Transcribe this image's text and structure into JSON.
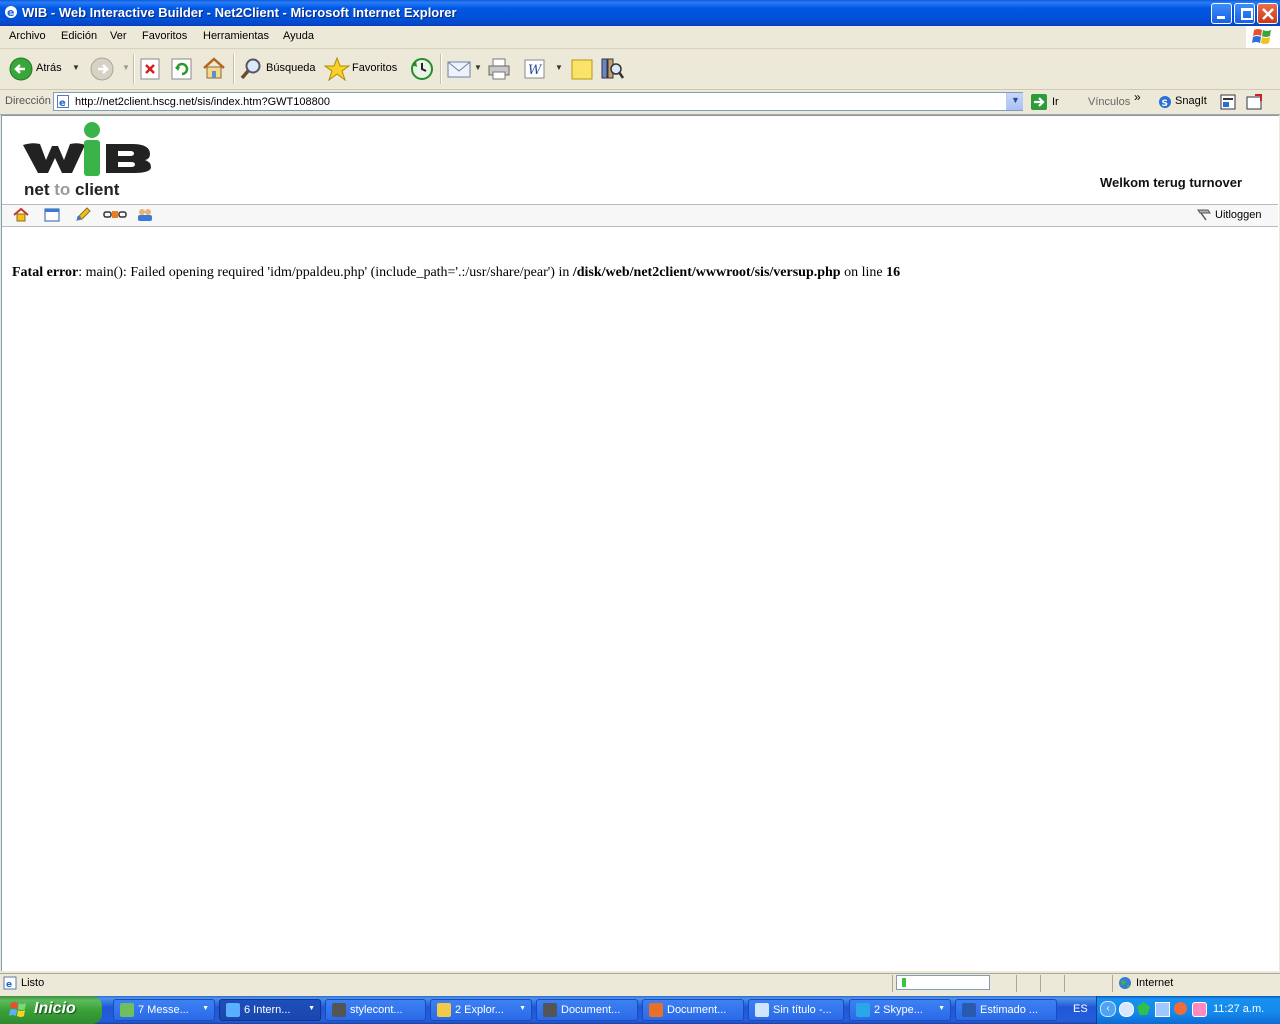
{
  "window": {
    "title": "WIB - Web Interactive Builder - Net2Client - Microsoft Internet Explorer"
  },
  "menu": [
    "Archivo",
    "Edición",
    "Ver",
    "Favoritos",
    "Herramientas",
    "Ayuda"
  ],
  "toolbar": {
    "back_label": "Atrás",
    "search_label": "Búsqueda",
    "favorites_label": "Favoritos"
  },
  "address": {
    "label": "Dirección",
    "url": "http://net2client.hscg.net/sis/index.htm?GWT108800",
    "go_label": "Ir",
    "links_label": "Vínculos",
    "links_chevron": "»",
    "snagit_label": "SnagIt"
  },
  "page": {
    "logo": {
      "letters": "WiB",
      "net": "net",
      "to": "to",
      "client": "client"
    },
    "welcome": "Welkom terug turnover",
    "site_toolbar_icons": [
      "home-icon",
      "folder-icon",
      "edit-icon",
      "link-icon",
      "users-icon"
    ],
    "logout_label": "Uitloggen",
    "error": {
      "label": "Fatal error",
      "message": ": main(): Failed opening required 'idm/ppaldeu.php' (include_path='.:/usr/share/pear') in ",
      "file": "/disk/web/net2client/wwwroot/sis/versup.php",
      "line_text": " on line ",
      "line": "16"
    }
  },
  "status": {
    "text": "Listo",
    "progress": 0.05,
    "zone": "Internet"
  },
  "taskbar": {
    "start_label": "Inicio",
    "tasks": [
      {
        "label": "7 Messe...",
        "icon": "messenger-icon",
        "active": false,
        "group": true
      },
      {
        "label": "6 Intern...",
        "icon": "ie-icon",
        "active": true,
        "group": true
      },
      {
        "label": "stylecont...",
        "icon": "app-icon",
        "active": false,
        "group": false
      },
      {
        "label": "2 Explor...",
        "icon": "folder-icon",
        "active": false,
        "group": true
      },
      {
        "label": "Document...",
        "icon": "app-icon",
        "active": false,
        "group": false
      },
      {
        "label": "Document...",
        "icon": "firefox-icon",
        "active": false,
        "group": false
      },
      {
        "label": "Sin título -...",
        "icon": "notepad-icon",
        "active": false,
        "group": false
      },
      {
        "label": "2 Skype...",
        "icon": "skype-icon",
        "active": false,
        "group": true
      },
      {
        "label": "Estimado ...",
        "icon": "word-icon",
        "active": false,
        "group": false
      }
    ],
    "language": "ES",
    "clock": "11:27 a.m."
  },
  "colors": {
    "titlebar": "#0058e6",
    "logo_green": "#3ab449",
    "taskbar": "#245edb",
    "start": "#39a339"
  }
}
